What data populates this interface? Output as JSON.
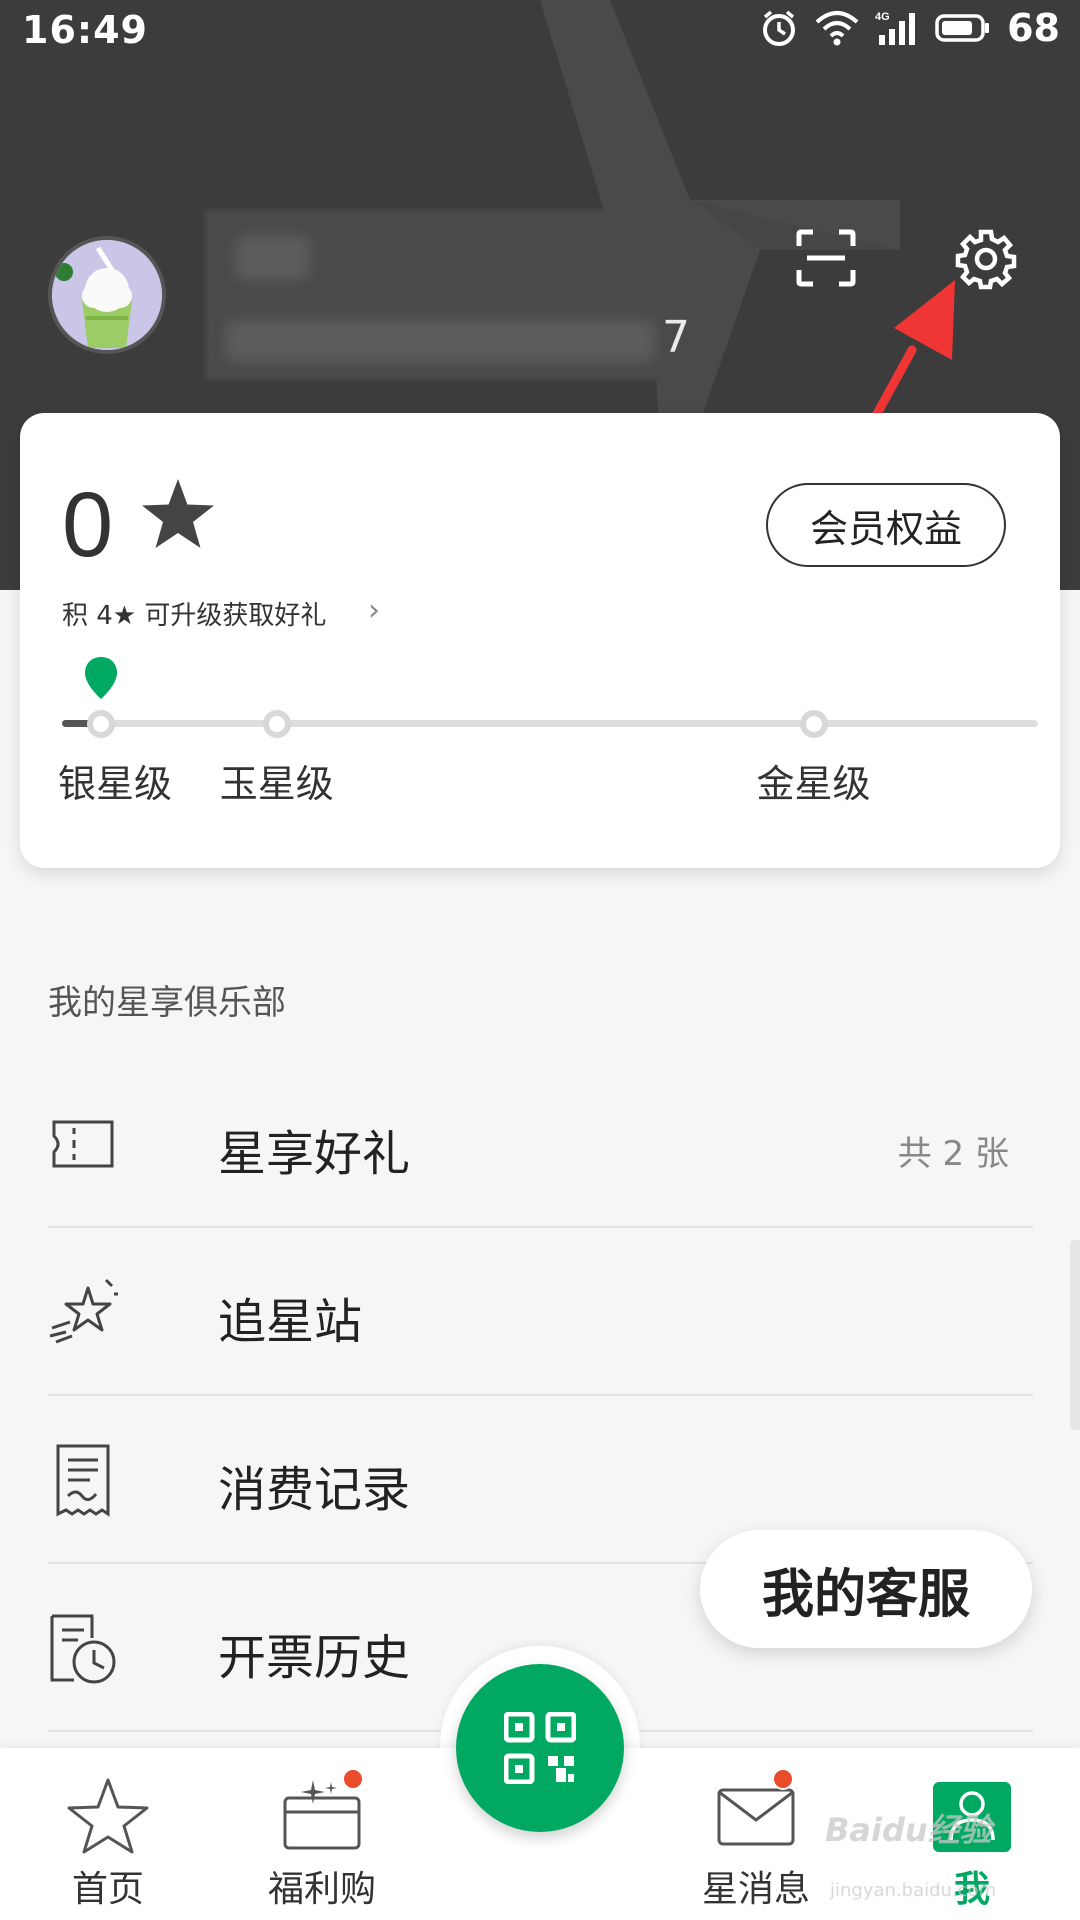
{
  "status_bar": {
    "time": "16:49",
    "network": "4G",
    "battery": "68",
    "icons": [
      "alarm-icon",
      "wifi-icon",
      "signal-icon",
      "battery-icon"
    ]
  },
  "profile": {
    "name_obscured": true,
    "number_suffix": "7",
    "icons": {
      "scan": "scan-icon",
      "settings": "gear-icon"
    }
  },
  "member_card": {
    "stars": "0",
    "star_icon": "star-icon",
    "benefits_button": "会员权益",
    "upgrade_hint": "积 4★ 可升级获取好礼",
    "chevron": "›",
    "progress_fraction": 0.04,
    "tiers": [
      {
        "label": "银星级",
        "position": 0.04
      },
      {
        "label": "玉星级",
        "position": 0.22
      },
      {
        "label": "金星级",
        "position": 0.77
      }
    ],
    "colors": {
      "pin": "#00a862",
      "fill": "#555555",
      "track": "#dddddd"
    }
  },
  "club": {
    "section_title": "我的星享俱乐部",
    "items": [
      {
        "label": "星享好礼",
        "extra": "共 2 张",
        "icon": "coupon-icon"
      },
      {
        "label": "追星站",
        "extra": "",
        "icon": "shooting-star-icon"
      },
      {
        "label": "消费记录",
        "extra": "",
        "icon": "receipt-icon"
      },
      {
        "label": "开票历史",
        "extra": "",
        "icon": "invoice-history-icon"
      }
    ]
  },
  "service_button": "我的客服",
  "bottom_nav": {
    "items": [
      {
        "label": "首页",
        "icon": "home-star-icon",
        "active": false,
        "badge": false
      },
      {
        "label": "福利购",
        "icon": "gift-card-icon",
        "active": false,
        "badge": true
      },
      {
        "label": "星消息",
        "icon": "mail-icon",
        "active": false,
        "badge": true
      },
      {
        "label": "我",
        "icon": "profile-icon",
        "active": true,
        "badge": false
      }
    ],
    "center_button_icon": "qr-code-icon"
  },
  "watermark": {
    "text": "Baidu经验",
    "sub": "jingyan.baidu.com"
  },
  "colors": {
    "accent": "#00a862",
    "header_bg": "#3c3c3c",
    "badge": "#e94c2a",
    "annotation_arrow": "#f03535"
  }
}
